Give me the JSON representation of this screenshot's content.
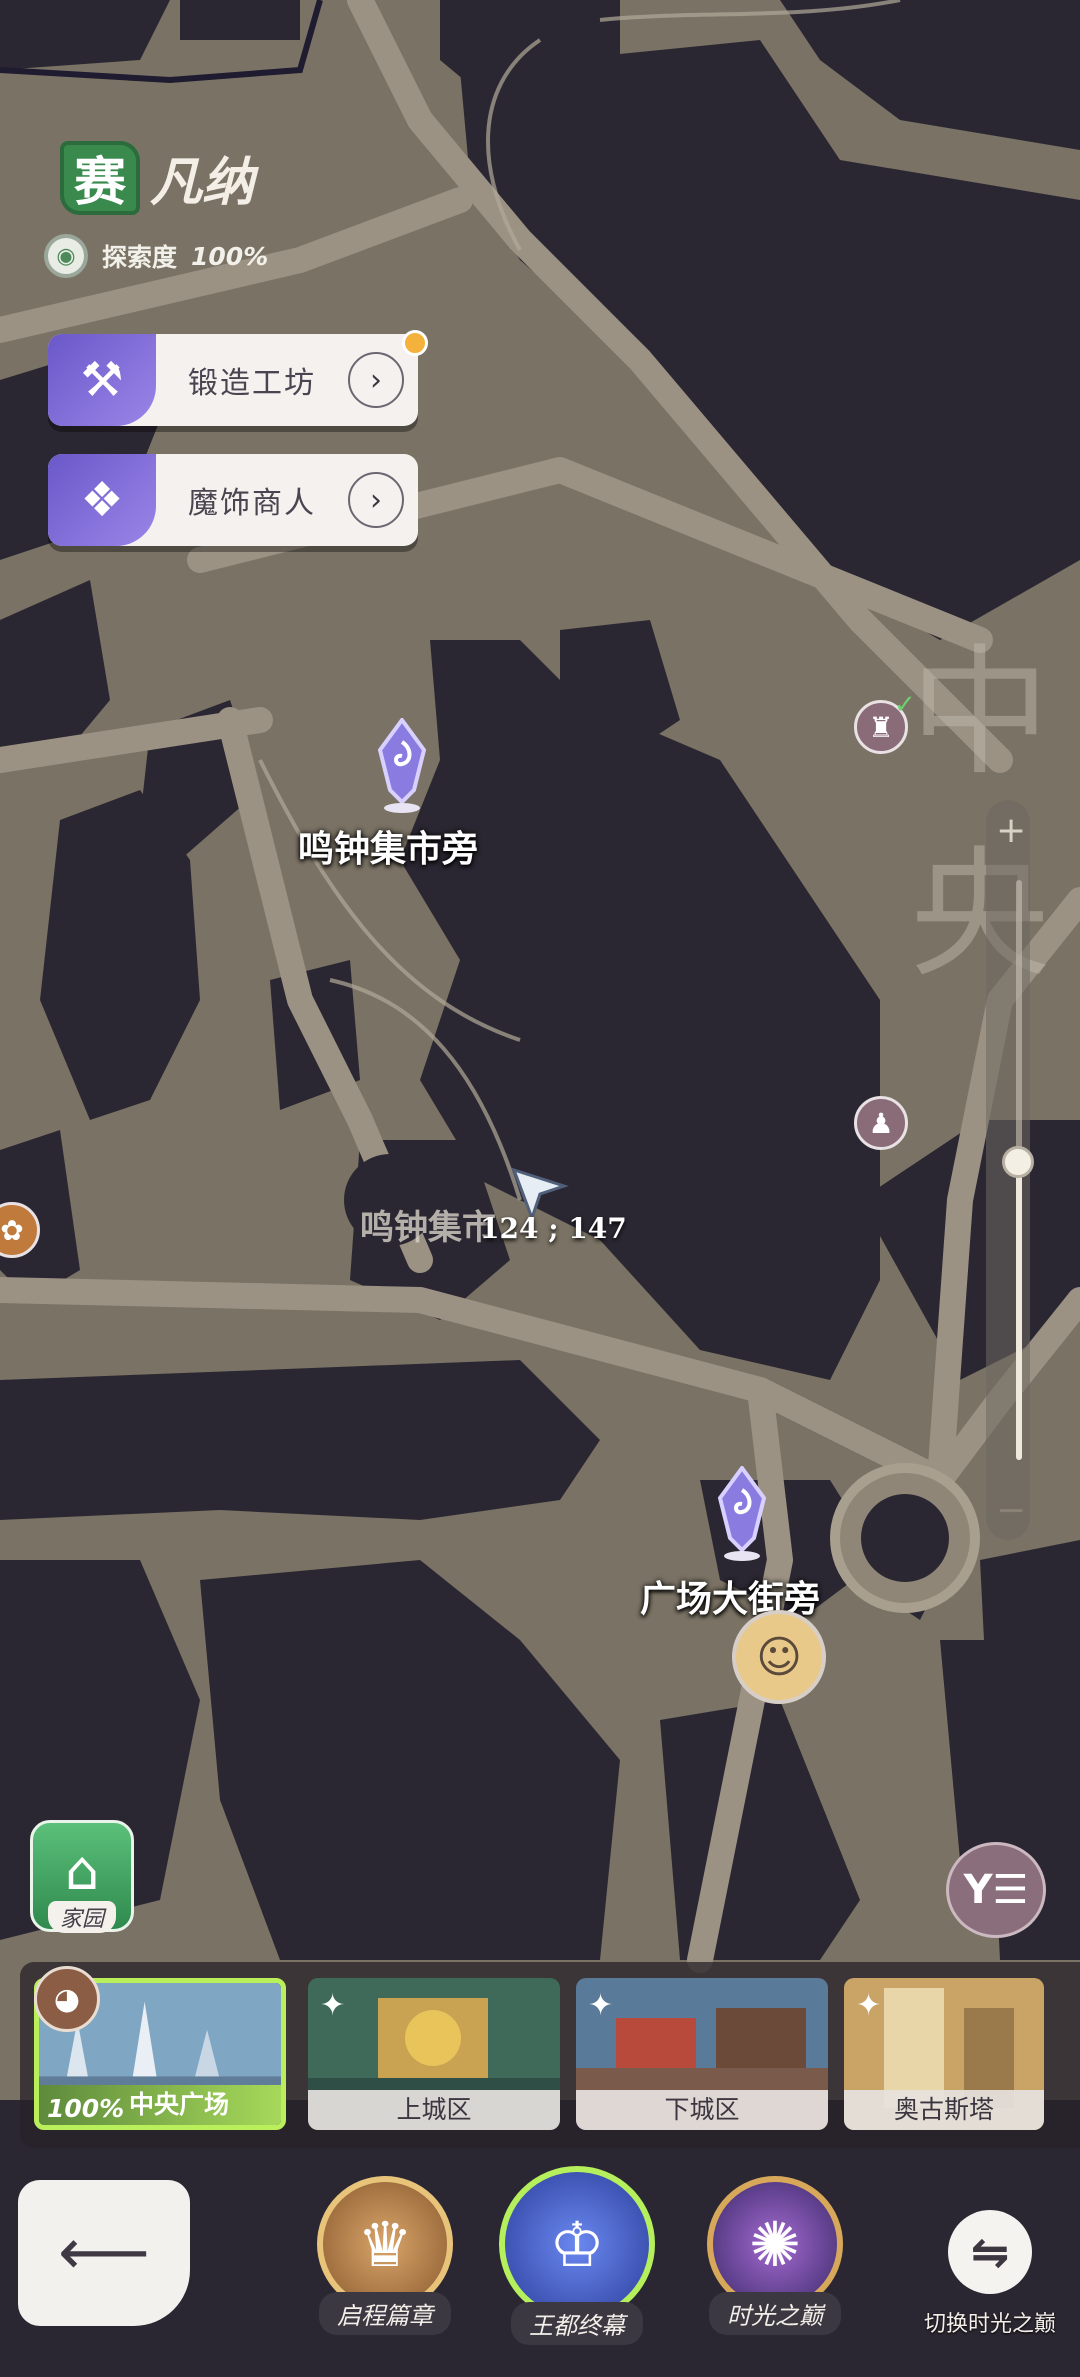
{
  "region": {
    "badge": "赛",
    "name": "凡纳",
    "explore_label": "探索度",
    "explore_value": "100%"
  },
  "shops": [
    {
      "label": "锻造工坊",
      "icon": "anvil-icon",
      "has_notification": true
    },
    {
      "label": "魔饰商人",
      "icon": "crystal-flower-icon",
      "has_notification": false
    }
  ],
  "map": {
    "waypoints": [
      {
        "label": "鸣钟集市旁"
      },
      {
        "label": "广场大街旁"
      }
    ],
    "area_label": "鸣钟集市",
    "coords": "124 ; 147",
    "ghost_text": "中央",
    "colors": {
      "ground": "#7a7264",
      "road": "#9b9284",
      "building": "#2b2732",
      "waypoint": "#7b6ad0"
    }
  },
  "zoom": {
    "plus": "+",
    "minus": "−",
    "level": 0.52
  },
  "home": {
    "label": "家园"
  },
  "filter": {
    "icon": "filter-list-icon"
  },
  "regions": [
    {
      "label": "中央广场",
      "progress": "100%",
      "active": true
    },
    {
      "label": "上城区",
      "active": false
    },
    {
      "label": "下城区",
      "active": false
    },
    {
      "label": "奥古斯塔",
      "active": false
    }
  ],
  "chapters": [
    {
      "label": "启程篇章"
    },
    {
      "label": "王都终幕"
    },
    {
      "label": "时光之巅"
    }
  ],
  "switch": {
    "label": "切换时光之巅"
  },
  "back": {
    "icon": "back-arrow-icon"
  }
}
